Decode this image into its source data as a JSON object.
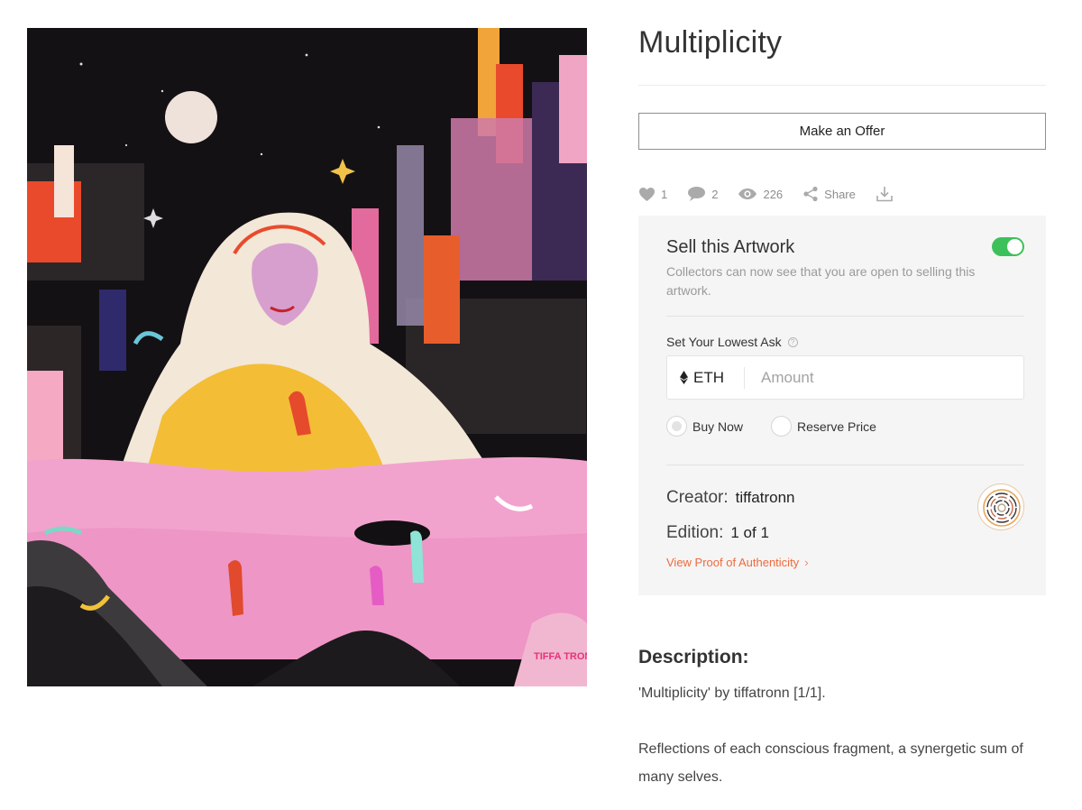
{
  "artwork": {
    "signature": "TIFFA TRONN"
  },
  "title": "Multiplicity",
  "make_offer_label": "Make an Offer",
  "stats": {
    "likes": "1",
    "comments": "2",
    "views": "226",
    "share_label": "Share",
    "icons": [
      "heart-icon",
      "comment-icon",
      "eye-icon",
      "share-icon",
      "download-icon"
    ]
  },
  "sell": {
    "title": "Sell this Artwork",
    "toggle_on": true,
    "description": "Collectors can now see that you are open to selling this artwork.",
    "ask_label": "Set Your Lowest Ask",
    "currency": "ETH",
    "amount_placeholder": "Amount",
    "options": [
      "Buy Now",
      "Reserve Price"
    ],
    "selected_option": "Buy Now"
  },
  "creator": {
    "label": "Creator:",
    "name": "tiffatronn"
  },
  "edition": {
    "label": "Edition:",
    "value": "1 of 1"
  },
  "proof_link": "View Proof of Authenticity",
  "description": {
    "title": "Description:",
    "paragraphs": [
      "'Multiplicity' by tiffatronn [1/1].",
      "Reflections of each conscious fragment, a synergetic sum of many selves."
    ]
  },
  "colors": {
    "toggle_on": "#3cc15a",
    "link": "#ee6a3e",
    "panel_bg": "#f5f5f5"
  }
}
